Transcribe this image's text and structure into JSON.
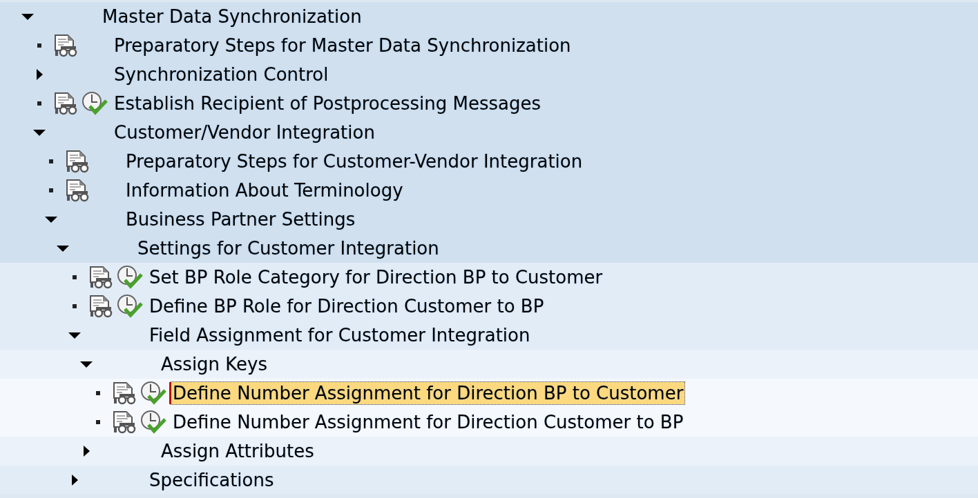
{
  "tree": [
    {
      "label": "Master Data Synchronization",
      "kind": "folder",
      "expanded": true,
      "selected": false,
      "children": [
        {
          "label": "Preparatory Steps for Master Data Synchronization",
          "kind": "document",
          "selected": false
        },
        {
          "label": "Synchronization Control",
          "kind": "folder",
          "expanded": false,
          "selected": false
        },
        {
          "label": "Establish Recipient of Postprocessing Messages",
          "kind": "activity",
          "selected": false
        },
        {
          "label": "Customer/Vendor Integration",
          "kind": "folder",
          "expanded": true,
          "selected": false,
          "children": [
            {
              "label": "Preparatory Steps for Customer-Vendor Integration",
              "kind": "document",
              "selected": false
            },
            {
              "label": "Information About Terminology",
              "kind": "document",
              "selected": false
            },
            {
              "label": "Business Partner Settings",
              "kind": "folder",
              "expanded": true,
              "selected": false,
              "children": [
                {
                  "label": "Settings for Customer Integration",
                  "kind": "folder",
                  "expanded": true,
                  "selected": false,
                  "children": [
                    {
                      "label": "Set BP Role Category for Direction BP to Customer",
                      "kind": "activity",
                      "selected": false
                    },
                    {
                      "label": "Define BP Role for Direction Customer to BP",
                      "kind": "activity",
                      "selected": false
                    },
                    {
                      "label": "Field Assignment for Customer Integration",
                      "kind": "folder",
                      "expanded": true,
                      "selected": false,
                      "children": [
                        {
                          "label": "Assign Keys",
                          "kind": "folder",
                          "expanded": true,
                          "selected": false,
                          "children": [
                            {
                              "label": "Define Number Assignment for Direction BP to Customer",
                              "kind": "activity",
                              "selected": true
                            },
                            {
                              "label": "Define Number Assignment for Direction Customer to BP",
                              "kind": "activity",
                              "selected": false
                            }
                          ]
                        },
                        {
                          "label": "Assign Attributes",
                          "kind": "folder",
                          "expanded": false,
                          "selected": false
                        }
                      ]
                    },
                    {
                      "label": "Specifications",
                      "kind": "folder",
                      "expanded": false,
                      "selected": false
                    }
                  ]
                }
              ]
            }
          ]
        }
      ]
    }
  ]
}
